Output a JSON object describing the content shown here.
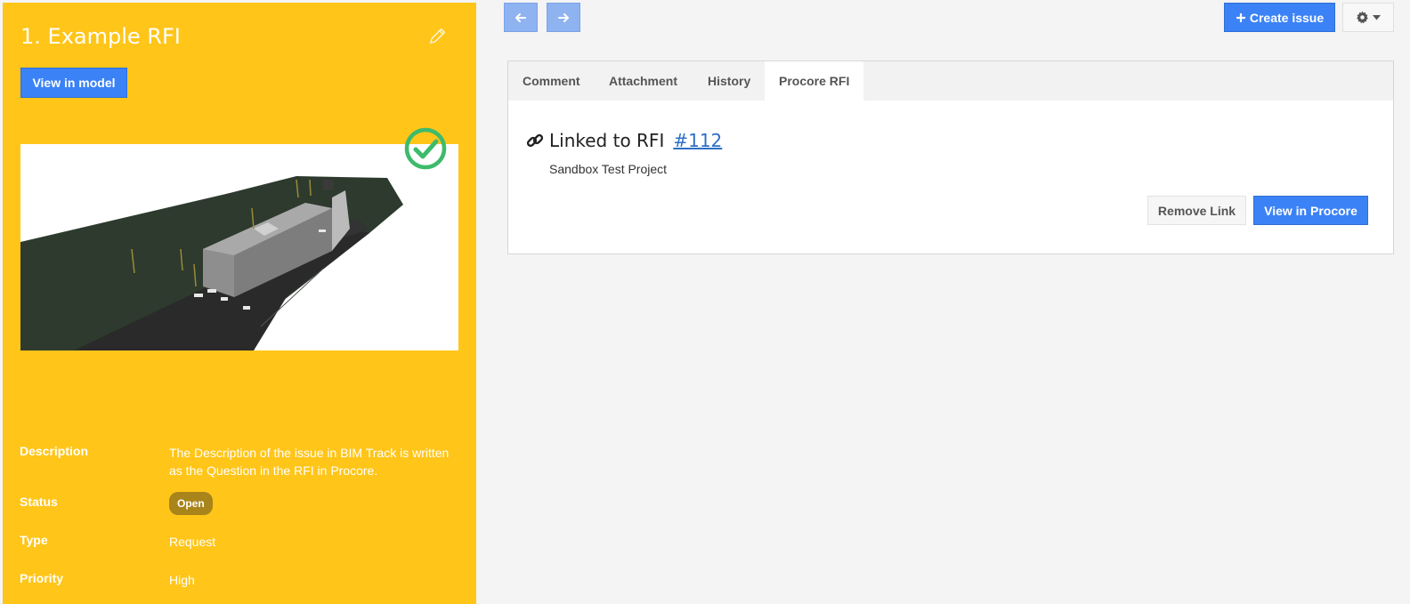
{
  "issue": {
    "title": "1. Example RFI",
    "view_in_model_label": "View in model"
  },
  "properties": {
    "description_label": "Description",
    "description_value": "The Description of the issue in BIM Track is written as the Question in the RFI in Procore.",
    "status_label": "Status",
    "status_value": "Open",
    "type_label": "Type",
    "type_value": "Request",
    "priority_label": "Priority",
    "priority_value": "High"
  },
  "toolbar": {
    "create_issue_label": "Create issue"
  },
  "tabs": [
    {
      "label": "Comment"
    },
    {
      "label": "Attachment"
    },
    {
      "label": "History"
    },
    {
      "label": "Procore RFI"
    }
  ],
  "procore": {
    "linked_text": "Linked to RFI",
    "rfi_number": "#112",
    "project_name": "Sandbox Test Project",
    "remove_link_label": "Remove Link",
    "view_in_procore_label": "View in Procore"
  },
  "colors": {
    "panel_bg": "#ffc519",
    "primary_blue": "#3b82f6",
    "status_badge": "#a8841a",
    "check_green": "#3dbb6b"
  }
}
